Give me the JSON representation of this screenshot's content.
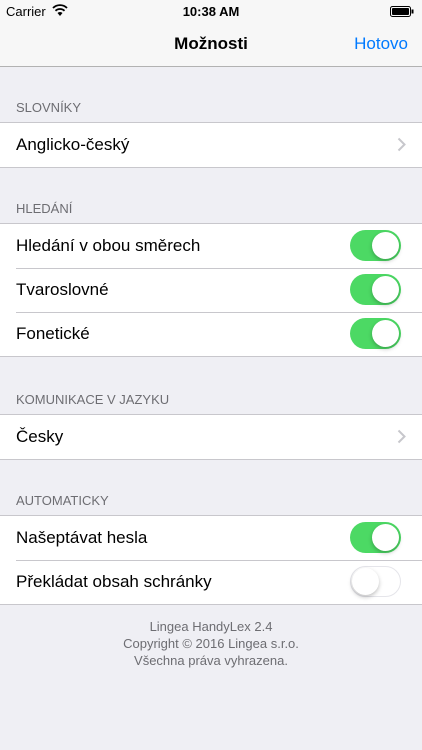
{
  "status_bar": {
    "carrier": "Carrier",
    "time": "10:38 AM"
  },
  "navbar": {
    "title": "Možnosti",
    "done_label": "Hotovo"
  },
  "sections": {
    "dictionaries": {
      "header": "SLOVNÍKY",
      "items": [
        {
          "label": "Anglicko-český"
        }
      ]
    },
    "search": {
      "header": "HLEDÁNÍ",
      "items": [
        {
          "label": "Hledání v obou směrech",
          "on": true
        },
        {
          "label": "Tvaroslovné",
          "on": true
        },
        {
          "label": "Fonetické",
          "on": true
        }
      ]
    },
    "communication": {
      "header": "KOMUNIKACE V JAZYKU",
      "items": [
        {
          "label": "Česky"
        }
      ]
    },
    "automatic": {
      "header": "AUTOMATICKY",
      "items": [
        {
          "label": "Našeptávat hesla",
          "on": true
        },
        {
          "label": "Překládat obsah schránky",
          "on": false
        }
      ]
    }
  },
  "footer": {
    "line1": "Lingea HandyLex 2.4",
    "line2": "Copyright © 2016 Lingea s.r.o.",
    "line3": "Všechna práva vyhrazena."
  },
  "colors": {
    "accent": "#007aff",
    "toggle_on": "#4cd964"
  }
}
